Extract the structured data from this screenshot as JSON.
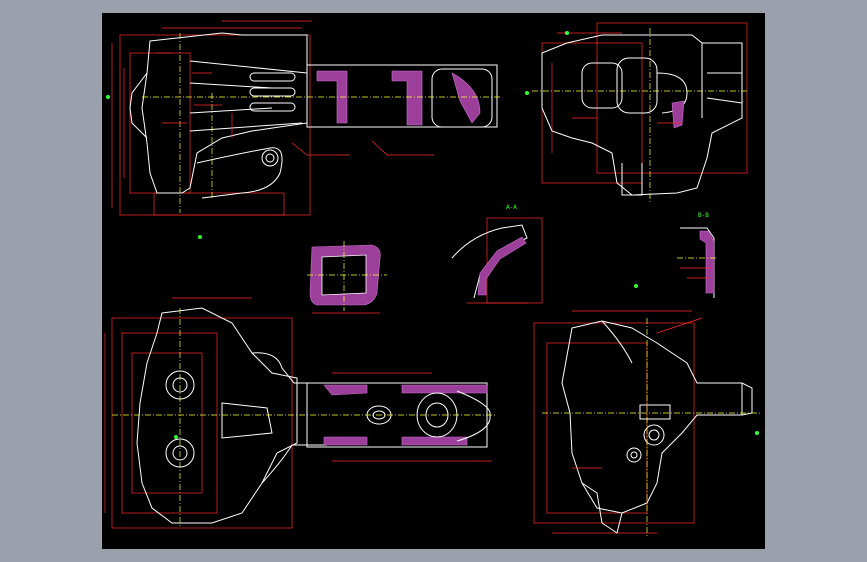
{
  "window": {
    "background": "#9aa1ad",
    "canvas_background": "#000000"
  },
  "colors": {
    "dimension": "#ff2a2a",
    "geometry": "#ffffff",
    "centerline": "#ffff33",
    "section_hatch": "#9b3f9b",
    "marker": "#33ff33"
  },
  "views": [
    {
      "id": "front-view"
    },
    {
      "id": "side-view"
    },
    {
      "id": "section-box"
    },
    {
      "id": "section-a"
    },
    {
      "id": "section-b"
    },
    {
      "id": "top-view"
    },
    {
      "id": "end-view"
    }
  ],
  "labels": {
    "section_a_title": "A-A",
    "section_b_title": "B-B"
  }
}
